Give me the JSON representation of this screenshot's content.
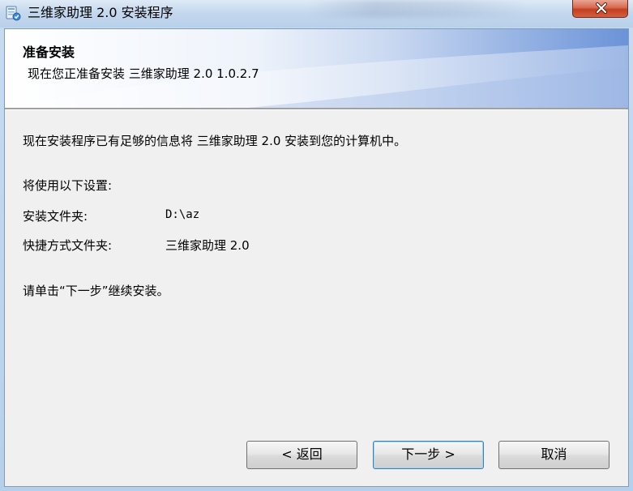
{
  "window": {
    "title": "三维家助理 2.0 安装程序"
  },
  "banner": {
    "title": "准备安装",
    "subtitle": "现在您正准备安装 三维家助理 2.0 1.0.2.7"
  },
  "content": {
    "intro": "现在安装程序已有足够的信息将 三维家助理 2.0 安装到您的计算机中。",
    "settings_heading": "将使用以下设置:",
    "install_folder_label": "安装文件夹:",
    "install_folder_value": "D:\\az",
    "shortcut_folder_label": "快捷方式文件夹:",
    "shortcut_folder_value": "三维家助理 2.0",
    "continue_hint": "请单击“下一步”继续安装。"
  },
  "buttons": {
    "back_label": "< 返回",
    "next_label": "下一步 >",
    "cancel_label": "取消"
  },
  "icons": {
    "app": "installer-app-icon",
    "close": "close-icon"
  },
  "colors": {
    "banner_accent": "#6b93d8",
    "close_button": "#c43e20",
    "window_frame": "#b7d0ea"
  }
}
